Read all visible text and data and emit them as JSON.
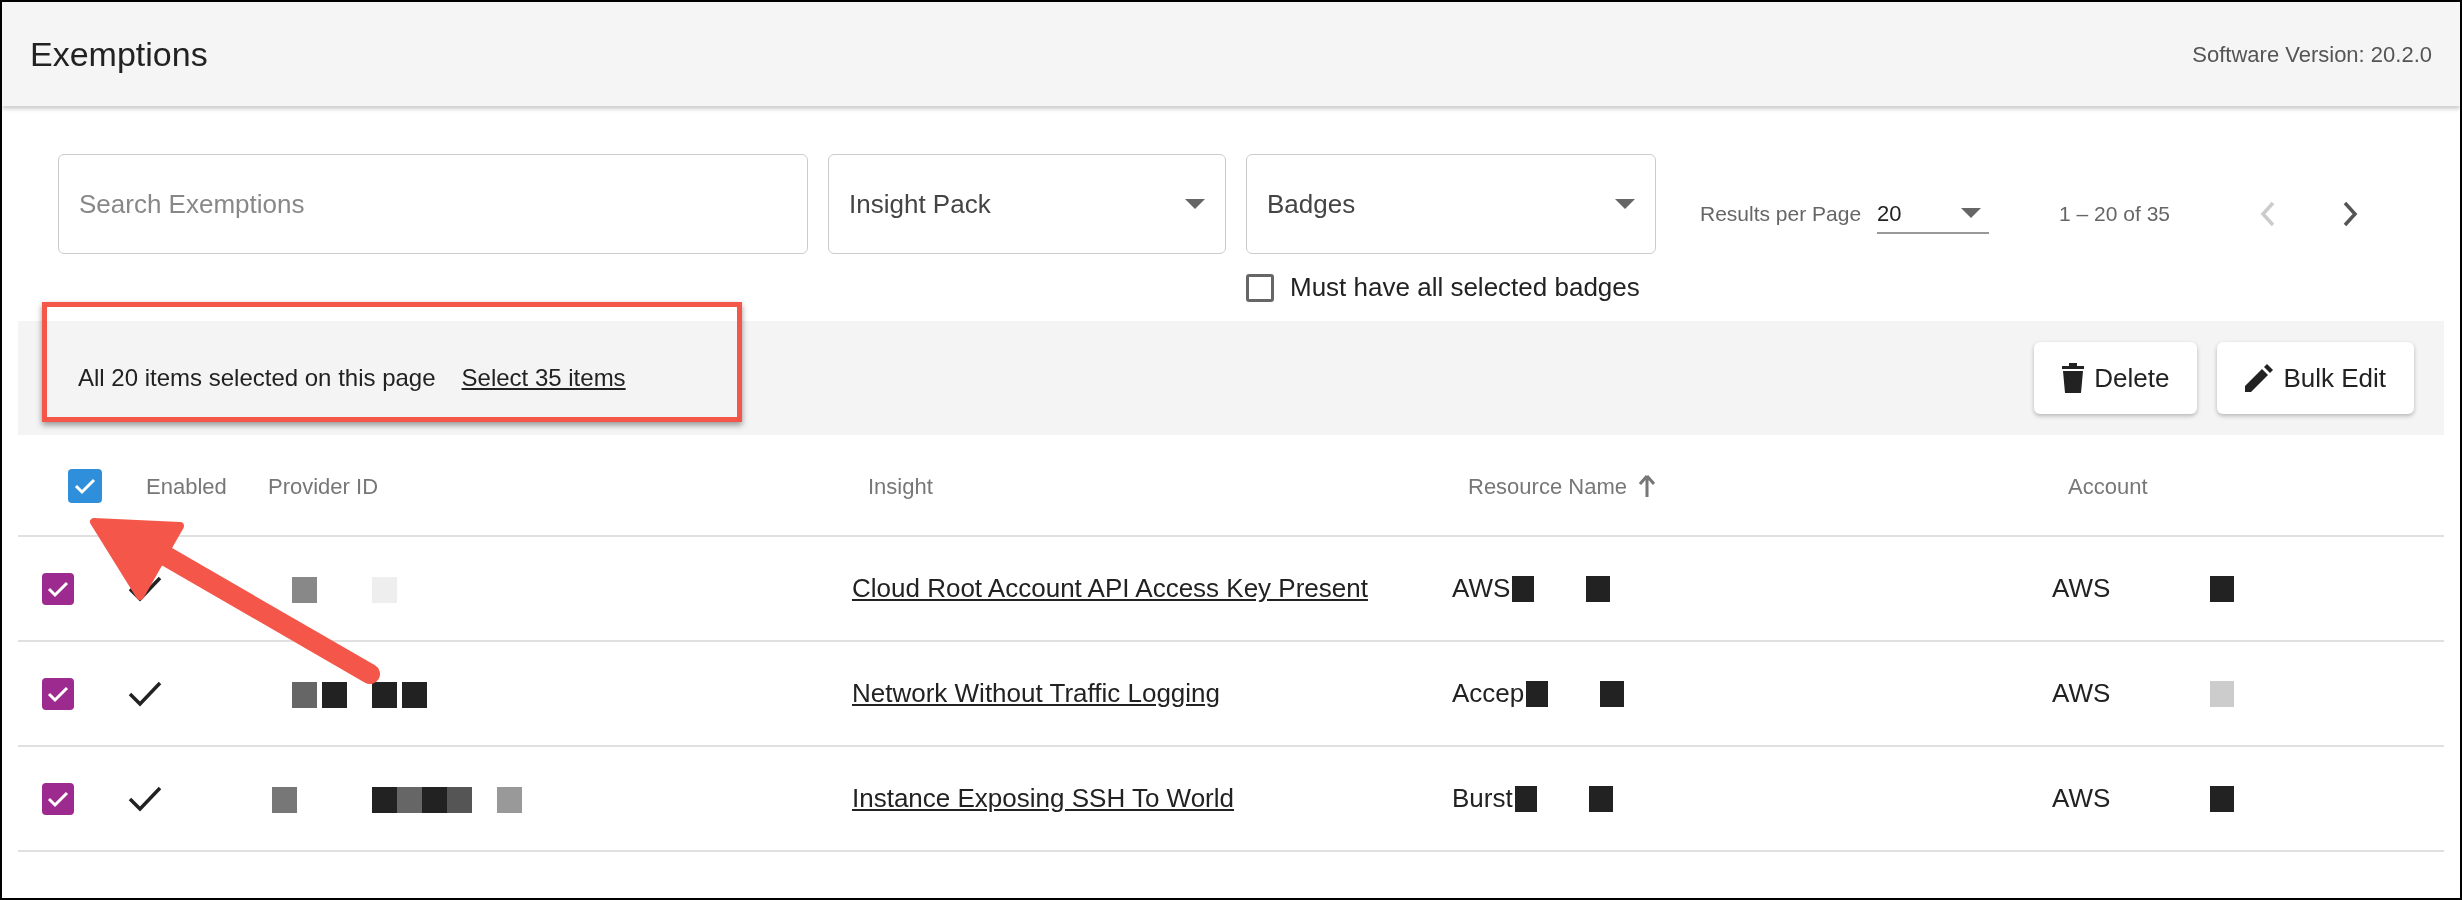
{
  "header": {
    "title": "Exemptions",
    "version": "Software Version: 20.2.0"
  },
  "filters": {
    "search": {
      "placeholder": "Search Exemptions"
    },
    "dropdowns": [
      {
        "label": "Insight Pack"
      },
      {
        "label": "Badges"
      }
    ],
    "must_have_all": {
      "label": "Must have all selected badges",
      "checked": false
    }
  },
  "pagination": {
    "label": "Results per Page",
    "per_page": "20",
    "range": "1 – 20 of 35",
    "prev_disabled": true,
    "next_disabled": false
  },
  "selection_bar": {
    "message": "All 20 items selected on this page",
    "link": "Select 35 items",
    "buttons": [
      {
        "kind": "delete",
        "label": "Delete"
      },
      {
        "kind": "edit",
        "label": "Bulk Edit"
      }
    ]
  },
  "table": {
    "select_all_checked": true,
    "columns": [
      {
        "label": "Enabled",
        "sorted": false
      },
      {
        "label": "Provider ID",
        "sorted": false
      },
      {
        "label": "Insight",
        "sorted": false
      },
      {
        "label": "Resource Name",
        "sorted": true
      },
      {
        "label": "Account",
        "sorted": false
      }
    ],
    "rows": [
      {
        "checked": true,
        "enabled": true,
        "insight": "Cloud Root Account API Access Key Present",
        "resource": "AWS",
        "account": "AWS"
      },
      {
        "checked": true,
        "enabled": true,
        "insight": "Network Without Traffic Logging",
        "resource": "Accep",
        "account": "AWS"
      },
      {
        "checked": true,
        "enabled": true,
        "insight": "Instance Exposing SSH To World",
        "resource": "Burst",
        "account": "AWS"
      }
    ]
  }
}
